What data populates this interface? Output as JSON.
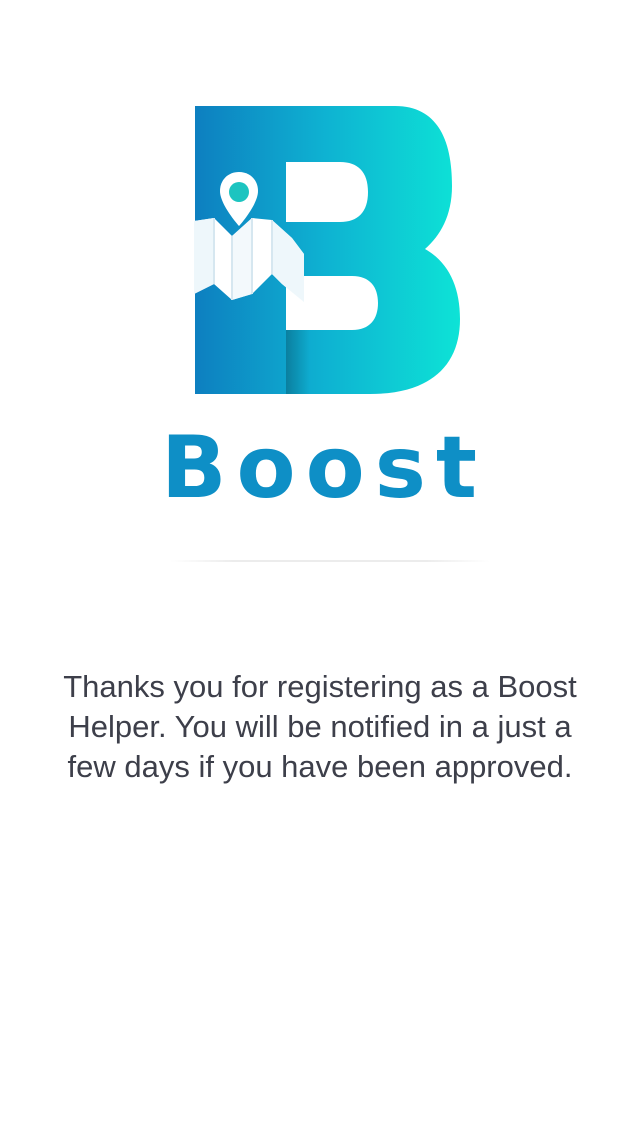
{
  "app": {
    "brand_name": "Boost",
    "logo_icon": "boost-b-map-pin-logo",
    "colors": {
      "brand_blue": "#0e8fc6",
      "gradient_start": "#0d7fc0",
      "gradient_end": "#0de3d6",
      "pin_teal": "#1cc4c0",
      "text": "#3d3f4a",
      "background": "#ffffff"
    }
  },
  "main": {
    "message": "Thanks you for registering as a Boost Helper. You will be notified in a just a few days if you have been approved."
  }
}
